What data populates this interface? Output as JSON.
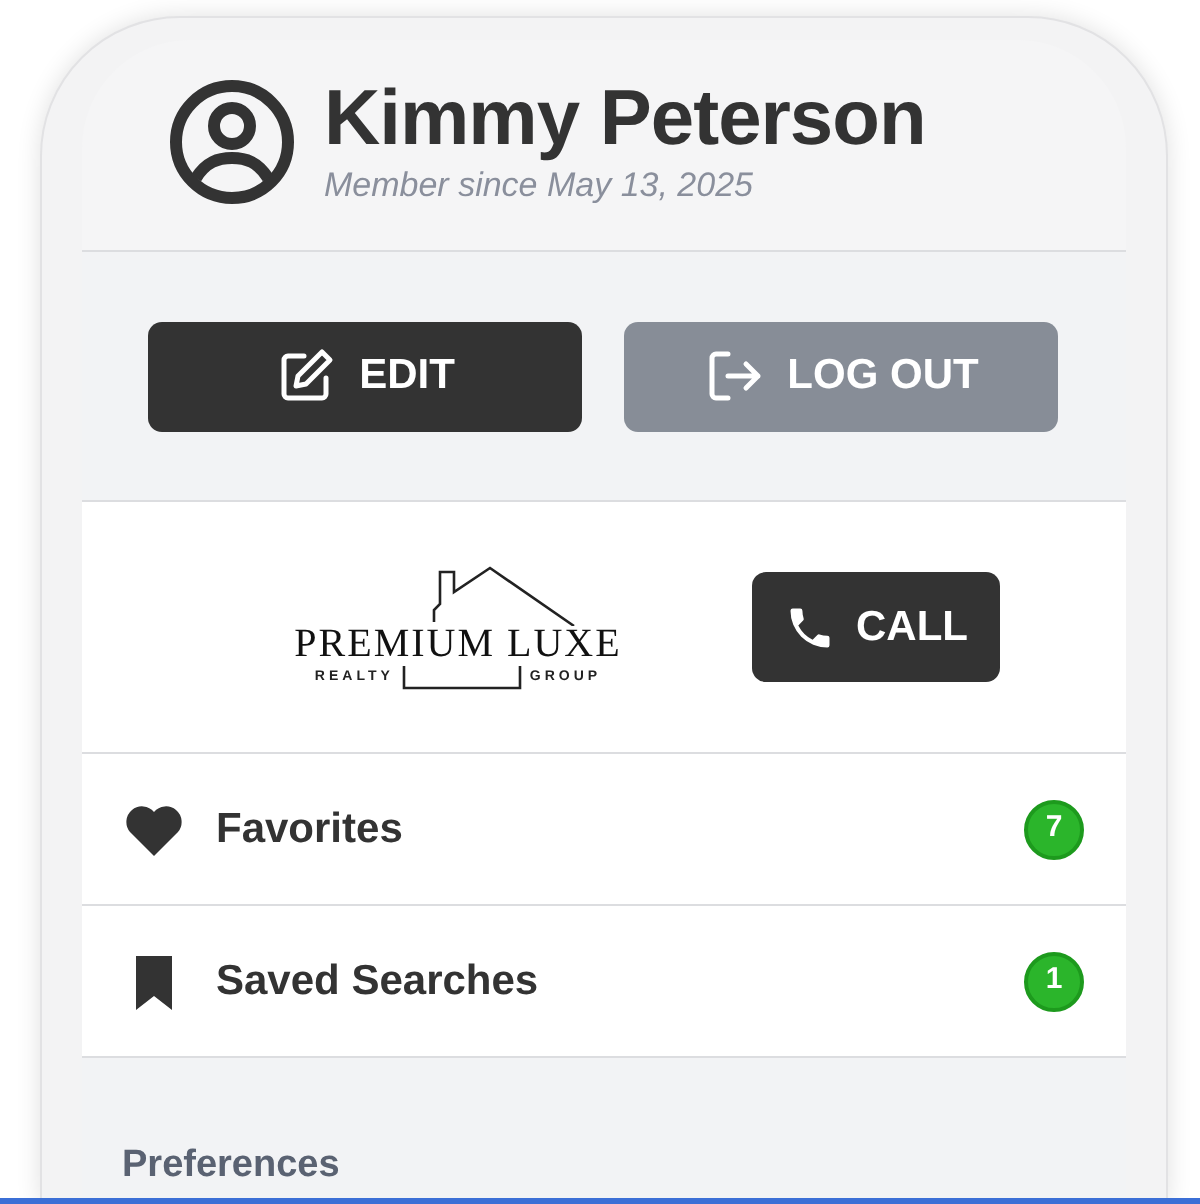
{
  "profile": {
    "name": "Kimmy Peterson",
    "member_since": "Member since May 13, 2025"
  },
  "actions": [
    {
      "kind": "edit",
      "label": "EDIT",
      "disabled": false
    },
    {
      "kind": "logout",
      "label": "LOG OUT",
      "disabled": true
    }
  ],
  "agent": {
    "logo_title": "PREMIUM LUXE",
    "logo_left": "REALTY",
    "logo_right": "GROUP",
    "call_label": "CALL"
  },
  "menu": [
    {
      "kind": "favorites",
      "label": "Favorites",
      "count": "7"
    },
    {
      "kind": "saved",
      "label": "Saved Searches",
      "count": "1"
    }
  ],
  "section_title": "Preferences"
}
